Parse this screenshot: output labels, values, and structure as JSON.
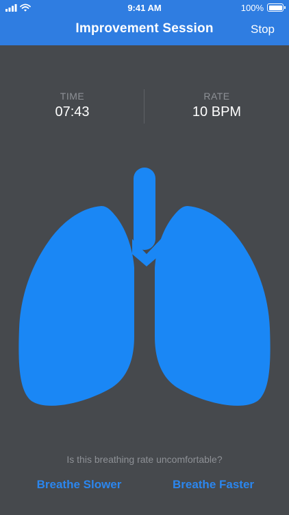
{
  "status_bar": {
    "time": "9:41 AM",
    "battery": "100%"
  },
  "nav": {
    "title": "Improvement Session",
    "stop_label": "Stop"
  },
  "metrics": {
    "time_label": "TIME",
    "time_value": "07:43",
    "rate_label": "RATE",
    "rate_value": "10 BPM"
  },
  "prompt": {
    "question": "Is this breathing rate uncomfortable?",
    "slower_label": "Breathe Slower",
    "faster_label": "Breathe Faster"
  },
  "colors": {
    "header": "#2f7de1",
    "background": "#46494d",
    "lungs": "#1a87f5",
    "action": "#2b86ee",
    "muted_text": "#8e9196"
  },
  "icons": [
    "signal-icon",
    "wifi-icon",
    "battery-icon",
    "lungs-icon"
  ]
}
